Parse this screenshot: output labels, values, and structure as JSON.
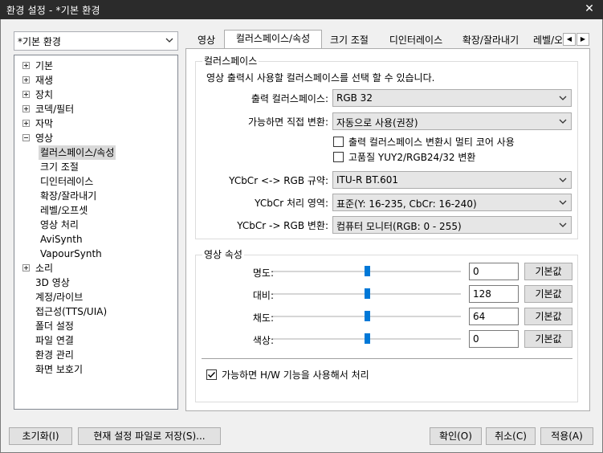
{
  "window": {
    "title": "환경 설정 - *기본 환경",
    "close_glyph": "✕"
  },
  "profile": {
    "value": "*기본 환경"
  },
  "tree": [
    {
      "label": "기본",
      "expander": "plus"
    },
    {
      "label": "재생",
      "expander": "plus"
    },
    {
      "label": "장치",
      "expander": "plus"
    },
    {
      "label": "코덱/필터",
      "expander": "plus"
    },
    {
      "label": "자막",
      "expander": "plus"
    },
    {
      "label": "영상",
      "expander": "minus"
    },
    {
      "label": "컬러스페이스/속성",
      "expander": "none",
      "selected": true
    },
    {
      "label": "크기 조절",
      "expander": "none"
    },
    {
      "label": "디인터레이스",
      "expander": "none"
    },
    {
      "label": "확장/잘라내기",
      "expander": "none"
    },
    {
      "label": "레벨/오프셋",
      "expander": "none"
    },
    {
      "label": "영상 처리",
      "expander": "none"
    },
    {
      "label": "AviSynth",
      "expander": "none"
    },
    {
      "label": "VapourSynth",
      "expander": "none"
    },
    {
      "label": "소리",
      "expander": "plus"
    },
    {
      "label": "3D 영상",
      "expander": "none"
    },
    {
      "label": "계정/라이브",
      "expander": "none"
    },
    {
      "label": "접근성(TTS/UIA)",
      "expander": "none"
    },
    {
      "label": "폴더 설정",
      "expander": "none"
    },
    {
      "label": "파일 연결",
      "expander": "none"
    },
    {
      "label": "환경 관리",
      "expander": "none"
    },
    {
      "label": "화면 보호기",
      "expander": "none"
    }
  ],
  "tabs": [
    {
      "label": "영상"
    },
    {
      "label": "컬러스페이스/속성",
      "active": true
    },
    {
      "label": "크기 조절"
    },
    {
      "label": "디인터레이스"
    },
    {
      "label": "확장/잘라내기"
    },
    {
      "label": "레벨/오"
    }
  ],
  "colorspace": {
    "title": "컬러스페이스",
    "description": "영상 출력시 사용할 컬러스페이스를 선택 할 수 있습니다.",
    "output_label": "출력 컬러스페이스:",
    "output_value": "RGB 32",
    "direct_label": "가능하면 직접 변환:",
    "direct_value": "자동으로 사용(권장)",
    "multicore_label": "출력 컬러스페이스 변환시 멀티 코어 사용",
    "multicore_checked": false,
    "hq_label": "고품질 YUY2/RGB24/32 변환",
    "hq_checked": false,
    "ycbcr_spec_label": "YCbCr <-> RGB 규약:",
    "ycbcr_spec_value": "ITU-R BT.601",
    "ycbcr_range_label": "YCbCr 처리 영역:",
    "ycbcr_range_value": "표준(Y: 16-235, CbCr: 16-240)",
    "ycbcr_rgb_label": "YCbCr -> RGB 변환:",
    "ycbcr_rgb_value": "컴퓨터 모니터(RGB: 0 - 255)"
  },
  "props": {
    "title": "영상 속성",
    "default_label": "기본값",
    "rows": [
      {
        "label": "명도:",
        "value": "0",
        "level_pct": 50
      },
      {
        "label": "대비:",
        "value": "128",
        "level_pct": 50
      },
      {
        "label": "채도:",
        "value": "64",
        "level_pct": 50
      },
      {
        "label": "색상:",
        "value": "0",
        "level_pct": 50
      }
    ],
    "hw_label": "가능하면 H/W 기능을 사용해서 처리",
    "hw_checked": true
  },
  "footer": {
    "reset": "초기화(I)",
    "save_to_file": "현재 설정 파일로 저장(S)...",
    "ok": "확인(O)",
    "cancel": "취소(C)",
    "apply": "적용(A)"
  },
  "colors": {
    "accent": "#0078d7",
    "titlebar": "#2b2b2b"
  }
}
